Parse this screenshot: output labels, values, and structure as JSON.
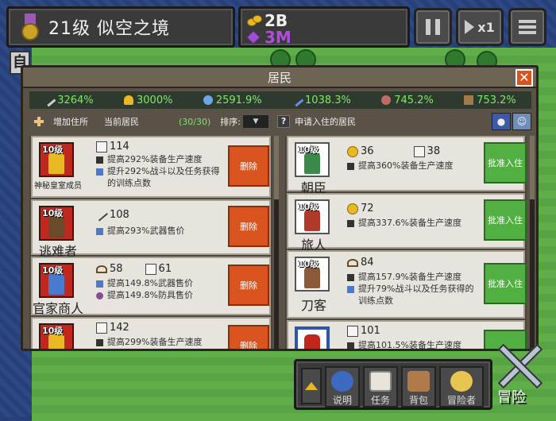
{
  "top": {
    "level_text": "21级 似空之境",
    "gold": "2B",
    "gems": "3M",
    "speed_label": "x1",
    "side_tab": "自"
  },
  "dialog": {
    "title": "居民",
    "close_label": "✕",
    "stats": [
      "3264%",
      "3000%",
      "2591.9%",
      "1038.3%",
      "745.2%",
      "753.2%"
    ],
    "toolbar": {
      "add_label": "增加住所",
      "current_label": "当前居民",
      "count": "(30/30)",
      "sort_label": "排序:",
      "help_label": "?",
      "apply_label": "申请入住的居民"
    }
  },
  "left_list": [
    {
      "level": "10级",
      "name": "神秘皇室成员",
      "value": "114",
      "lines": [
        "提高292%装备生产速度",
        "提升292%战斗以及任务获得",
        "的训练点数"
      ],
      "button": "删除"
    },
    {
      "level": "10级",
      "name": "逃难者",
      "value": "108",
      "lines": [
        "提高293%武器售价"
      ],
      "button": "删除"
    },
    {
      "level": "10级",
      "name": "官家商人",
      "value": "58",
      "value2": "61",
      "lines": [
        "提高149.8%武器售价",
        "提高149.8%防具售价"
      ],
      "button": "删除"
    },
    {
      "level": "10级",
      "name": "",
      "value": "142",
      "lines": [
        "提高299%装备生产速度"
      ],
      "button": "删除"
    }
  ],
  "right_list": [
    {
      "level": "10级",
      "name": "朝臣",
      "value": "36",
      "value2": "38",
      "lines": [
        "提高360%装备生产速度"
      ],
      "button": "批准入住"
    },
    {
      "level": "10级",
      "name": "旅人",
      "value": "72",
      "lines": [
        "提高337.6%装备生产速度"
      ],
      "button": "批准入住"
    },
    {
      "level": "10级",
      "name": "刀客",
      "value": "84",
      "lines": [
        "提高157.9%装备生产速度",
        "提升79%战斗以及任务获得的",
        "训练点数"
      ],
      "button": "批准入住"
    },
    {
      "level": "",
      "name": "",
      "value": "101",
      "lines": [
        "提高101.5%装备生产速度"
      ],
      "button": ""
    }
  ],
  "bottom": {
    "help": "说明",
    "quest": "任务",
    "bag": "背包",
    "adventurer": "冒险者",
    "adventure": "冒险"
  },
  "colors": {
    "stat_green": "#7de86a",
    "delete_red": "#d9541e",
    "approve_green": "#52b043",
    "gem_purple": "#b24be0"
  }
}
